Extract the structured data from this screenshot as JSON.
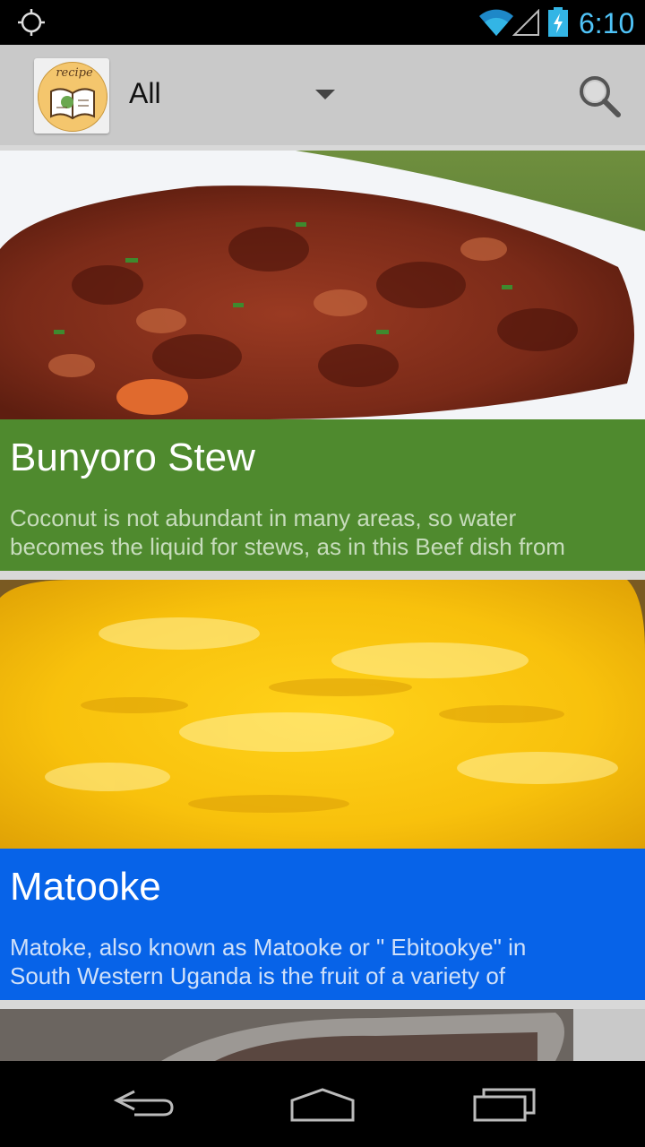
{
  "status_bar": {
    "time": "6:10",
    "icons": [
      "gps-icon",
      "wifi-icon",
      "signal-icon",
      "battery-charging-icon"
    ]
  },
  "action_bar": {
    "logo_text": "recipe",
    "filter_value": "All",
    "icons": [
      "app-logo-icon",
      "dropdown-arrow-icon",
      "search-icon"
    ]
  },
  "recipes": [
    {
      "title": "Bunyoro Stew",
      "description_line1": "Coconut is not abundant in many areas, so water",
      "description_line2": "becomes the liquid for stews, as in this Beef dish from",
      "color": "#4f8a2e",
      "desc_color": "#c7dcbc"
    },
    {
      "title": "Matooke",
      "description_line1": "Matoke, also known as Matooke or \" Ebitookye\" in",
      "description_line2": "South Western Uganda is the fruit of a variety of",
      "color": "#0763e8",
      "desc_color": "#cfe0f9"
    }
  ],
  "nav_bar": {
    "icons": [
      "back-icon",
      "home-icon",
      "recent-apps-icon"
    ]
  }
}
